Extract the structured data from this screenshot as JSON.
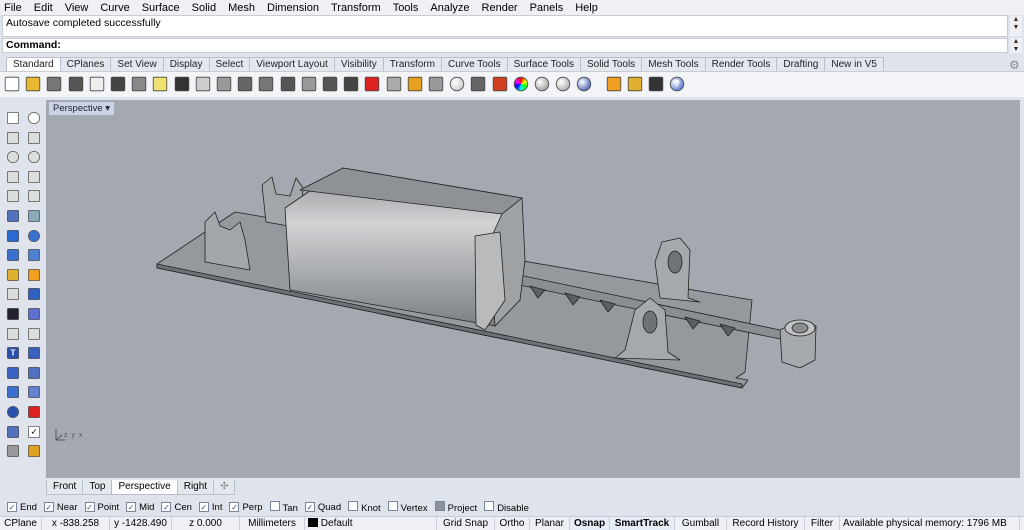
{
  "menu": [
    "File",
    "Edit",
    "View",
    "Curve",
    "Surface",
    "Solid",
    "Mesh",
    "Dimension",
    "Transform",
    "Tools",
    "Analyze",
    "Render",
    "Panels",
    "Help"
  ],
  "command_history": "Autosave completed successfully",
  "command_prompt": "Command:",
  "toolbar_tabs": [
    "Standard",
    "CPlanes",
    "Set View",
    "Display",
    "Select",
    "Viewport Layout",
    "Visibility",
    "Transform",
    "Curve Tools",
    "Surface Tools",
    "Solid Tools",
    "Mesh Tools",
    "Render Tools",
    "Drafting",
    "New in V5"
  ],
  "active_toolbar_tab": "Standard",
  "toolbar_icons": [
    "new-file",
    "open-folder",
    "save",
    "print",
    "import",
    "cut",
    "copy",
    "paste",
    "undo",
    "pan-hand",
    "rotate-view",
    "zoom",
    "zoom-window",
    "zoom-extents",
    "zoom-selected",
    "undo-view",
    "four-viewports",
    "car-properties",
    "cplane",
    "set-cplane",
    "object-properties",
    "light-bulb",
    "lock",
    "layer-render",
    "color-wheel",
    "sphere-shaded",
    "sphere-rendered",
    "sphere-blue",
    "filter",
    "options-gear",
    "dimension",
    "help"
  ],
  "left_toolbar_icons": [
    "select-arrow",
    "point",
    "polyline",
    "curve",
    "circle",
    "ellipse",
    "arc",
    "rectangle",
    "polygon",
    "fillet-curve",
    "surface-corners",
    "extrude-surface",
    "box",
    "sphere",
    "cylinder",
    "loft",
    "boolean",
    "explode",
    "split",
    "trim",
    "join-dots",
    "group",
    "offset",
    "blend",
    "text",
    "scale",
    "array",
    "move",
    "solid-edit",
    "hatch",
    "grid-points",
    "gumball",
    "cage",
    "check",
    "shade",
    "render"
  ],
  "viewport": {
    "label": "Perspective",
    "axis_label": "z y x"
  },
  "viewport_tabs": [
    "Front",
    "Top",
    "Perspective",
    "Right"
  ],
  "active_viewport_tab": "Perspective",
  "osnaps": [
    {
      "label": "End",
      "checked": true
    },
    {
      "label": "Near",
      "checked": true
    },
    {
      "label": "Point",
      "checked": true
    },
    {
      "label": "Mid",
      "checked": true
    },
    {
      "label": "Cen",
      "checked": true
    },
    {
      "label": "Int",
      "checked": true
    },
    {
      "label": "Perp",
      "checked": true
    },
    {
      "label": "Tan",
      "checked": false
    },
    {
      "label": "Quad",
      "checked": true
    },
    {
      "label": "Knot",
      "checked": false
    },
    {
      "label": "Vertex",
      "checked": false
    },
    {
      "label": "Project",
      "checked": true
    },
    {
      "label": "Disable",
      "checked": false
    }
  ],
  "status": {
    "cplane": "CPlane",
    "x": "x -838.258",
    "y": "y -1428.490",
    "z": "z 0.000",
    "units": "Millimeters",
    "layer": "Default",
    "grid_snap": "Grid Snap",
    "ortho": "Ortho",
    "planar": "Planar",
    "osnap": "Osnap",
    "smarttrack": "SmartTrack",
    "gumball": "Gumball",
    "record_history": "Record History",
    "filter": "Filter",
    "memory": "Available physical memory: 1796 MB"
  },
  "colors": {
    "viewport_bg": "#a3a8b1",
    "model": "#9a9da1",
    "layer_swatch": "#000000"
  }
}
